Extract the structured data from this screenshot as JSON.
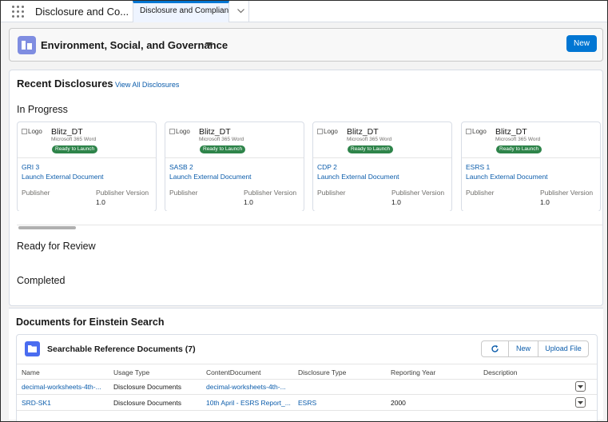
{
  "nav": {
    "app_name": "Disclosure and Co...",
    "tab_label": "Disclosure and Complian...",
    "tab_close": "✕"
  },
  "header": {
    "title": "Environment, Social, and Governance",
    "new_label": "New"
  },
  "recent": {
    "title": "Recent Disclosures",
    "view_all": "View All Disclosures",
    "in_progress": "In Progress",
    "ready_for_review": "Ready for Review",
    "completed": "Completed",
    "cards": [
      {
        "logo_alt": "Logo",
        "name": "Blitz_DT",
        "sub": "Microsoft 365 Word",
        "badge": "Ready to Launch",
        "id": "GRI 3",
        "launch": "Launch External Document",
        "publisher_label": "Publisher",
        "pv_label": "Publisher Version",
        "version": "1.0"
      },
      {
        "logo_alt": "Logo",
        "name": "Blitz_DT",
        "sub": "Microsoft 365 Word",
        "badge": "Ready to Launch",
        "id": "SASB 2",
        "launch": "Launch External Document",
        "publisher_label": "Publisher",
        "pv_label": "Publisher Version",
        "version": "1.0"
      },
      {
        "logo_alt": "Logo",
        "name": "Blitz_DT",
        "sub": "Microsoft 365 Word",
        "badge": "Ready to Launch",
        "id": "CDP 2",
        "launch": "Launch External Document",
        "publisher_label": "Publisher",
        "pv_label": "Publisher Version",
        "version": "1.0"
      },
      {
        "logo_alt": "Logo",
        "name": "Blitz_DT",
        "sub": "Microsoft 365 Word",
        "badge": "Ready to Launch",
        "id": "ESRS 1",
        "launch": "Launch External Document",
        "publisher_label": "Publisher",
        "pv_label": "Publisher Version",
        "version": "1.0"
      }
    ]
  },
  "einstein": {
    "title": "Documents for Einstein Search",
    "related_title": "Searchable Reference Documents (7)",
    "new_label": "New",
    "upload_label": "Upload File",
    "columns": [
      "Name",
      "Usage Type",
      "ContentDocument",
      "Disclosure Type",
      "Reporting Year",
      "Description"
    ],
    "rows": [
      [
        "decimal-worksheets-4th-...",
        "Disclosure Documents",
        "decimal-worksheets-4th-...",
        "",
        "",
        ""
      ],
      [
        "SRD-SK1",
        "Disclosure Documents",
        "10th April - ESRS Report_...",
        "ESRS",
        "2000",
        ""
      ]
    ]
  },
  "colors": {
    "brand": "#0176d3",
    "link": "#0b5cab",
    "badge_green": "#2e844a",
    "header_icon": "#7f8de1",
    "related_icon": "#4a6cf0"
  }
}
